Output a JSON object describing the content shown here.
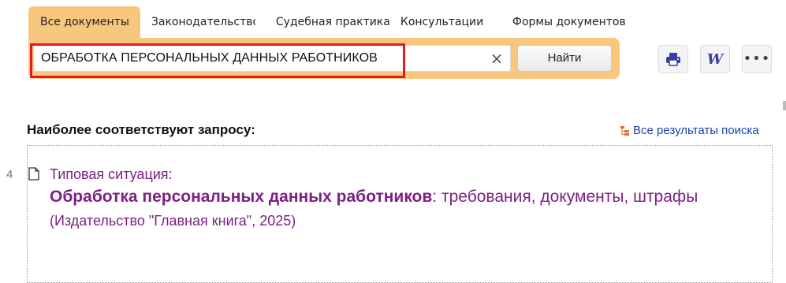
{
  "tabs": [
    {
      "label": "Все документы",
      "active": true
    },
    {
      "label": "Законодательство",
      "active": false
    },
    {
      "label": "Судебная практика",
      "active": false
    },
    {
      "label": "Консультации",
      "active": false
    },
    {
      "label": "Формы документов",
      "active": false
    }
  ],
  "search": {
    "value": "ОБРАБОТКА ПЕРСОНАЛЬНЫХ ДАННЫХ РАБОТНИКОВ",
    "clear_glyph": "×",
    "find_label": "Найти"
  },
  "toolbar": {
    "print_icon": "print-icon",
    "word_icon": "word-export-icon",
    "word_glyph": "W",
    "more_icon": "more-icon",
    "more_glyph": "•••"
  },
  "results": {
    "heading": "Наиболее соответствуют запросу:",
    "all_results_label": "Все результаты поиска",
    "items": [
      {
        "number": "4",
        "prefix": "Типовая ситуация:",
        "title_bold": "Обработка персональных данных работников",
        "title_rest": ": требования, документы, штрафы",
        "meta": "(Издательство \"Главная книга\", 2025)"
      }
    ]
  },
  "colors": {
    "accent": "#f7c77e",
    "highlight_frame": "#e01b24",
    "link": "#7d1f84",
    "all_results_link": "#1a3fb0"
  }
}
